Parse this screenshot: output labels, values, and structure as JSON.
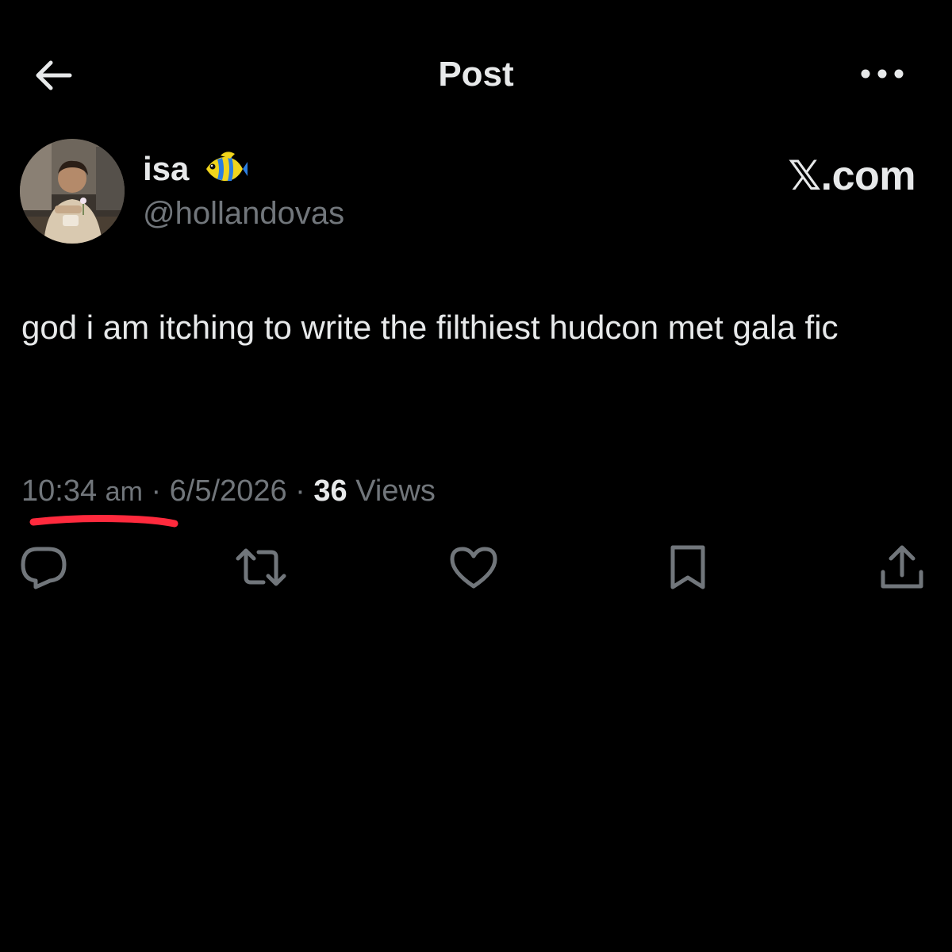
{
  "header": {
    "title": "Post",
    "back_icon": "arrow-left-icon",
    "more_icon": "more-horizontal-icon"
  },
  "author": {
    "display_name": "isa",
    "name_emoji_icon": "tropical-fish-icon",
    "handle": "@hollandovas",
    "avatar": "profile-photo"
  },
  "watermark": "𝕏.com",
  "post": {
    "text": "god i am itching to write the filthiest hudcon met gala fic"
  },
  "meta": {
    "time": "10:34",
    "meridiem": "am",
    "separator": "·",
    "date": "6/5/2026",
    "views_count": "36",
    "views_label": "Views"
  },
  "annotation": {
    "underline_color": "#ff2a3d"
  },
  "actions": [
    {
      "name": "reply",
      "icon": "reply-icon"
    },
    {
      "name": "repost",
      "icon": "repost-icon"
    },
    {
      "name": "like",
      "icon": "heart-icon"
    },
    {
      "name": "bookmark",
      "icon": "bookmark-icon"
    },
    {
      "name": "share",
      "icon": "share-icon"
    }
  ],
  "colors": {
    "background": "#000000",
    "primary_text": "#e7e9ea",
    "secondary_text": "#71767b"
  }
}
